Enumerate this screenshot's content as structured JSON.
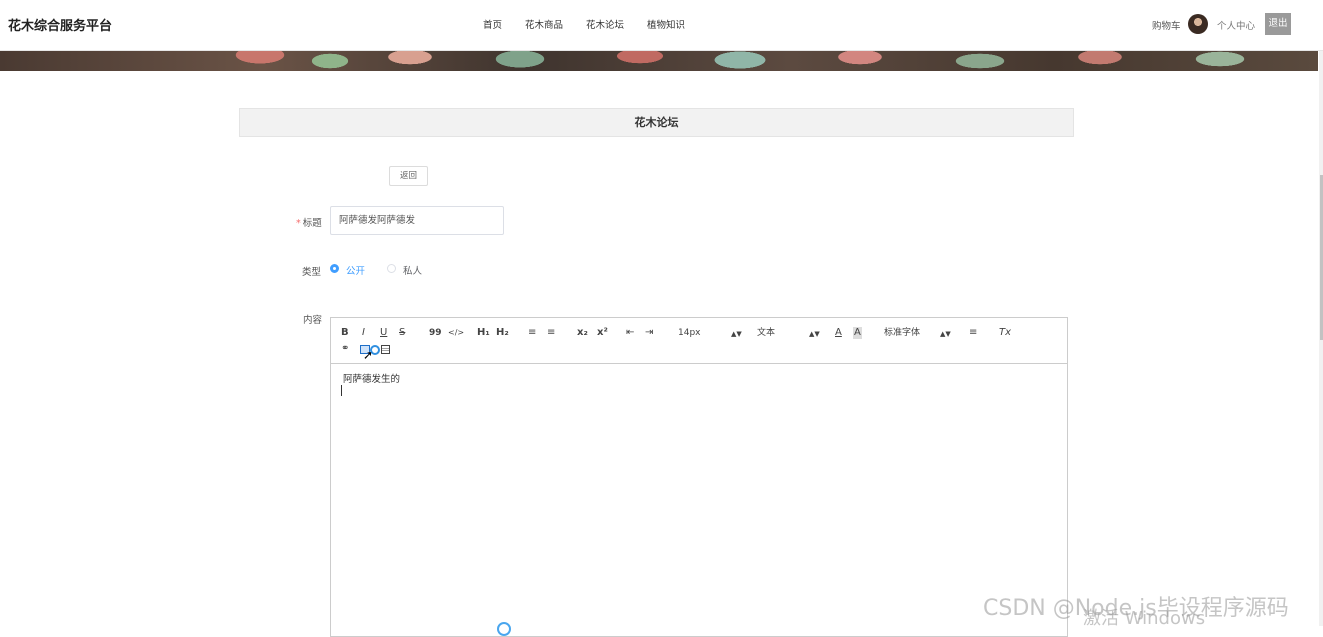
{
  "header": {
    "brand": "花木综合服务平台",
    "nav": [
      "首页",
      "花木商品",
      "花木论坛",
      "植物知识"
    ],
    "cart": "购物车",
    "user_center": "个人中心",
    "logout": "退出"
  },
  "section": {
    "title": "花木论坛"
  },
  "form": {
    "back_button": "返回",
    "title_label": "标题",
    "required_mark": "*",
    "title_value": "阿萨德发阿萨德发",
    "type_label": "类型",
    "type_options": [
      {
        "label": "公开",
        "selected": true
      },
      {
        "label": "私人",
        "selected": false
      }
    ],
    "content_label": "内容"
  },
  "editor": {
    "toolbar": {
      "bold": "B",
      "italic": "I",
      "underline": "U",
      "strike": "S",
      "quote": "99",
      "code": "</>",
      "h1": "H₁",
      "h2": "H₂",
      "ordered_list": "≡",
      "bullet_list": "≡",
      "subscript": "x₂",
      "superscript": "x²",
      "outdent": "⇤",
      "indent": "⇥",
      "size_select": "14px",
      "header_select": "文本",
      "font_color": "A",
      "background_color": "A",
      "font_select": "标准字体",
      "align": "≡",
      "clean": "Tx"
    },
    "content_text": "阿萨德发生的"
  },
  "watermark": {
    "csdn": "CSDN @Node.js毕设程序源码",
    "windows": "激活 Windows"
  },
  "colors": {
    "accent": "#409eff",
    "required": "#f56c6c",
    "logout_bg": "#9a9a9a"
  }
}
